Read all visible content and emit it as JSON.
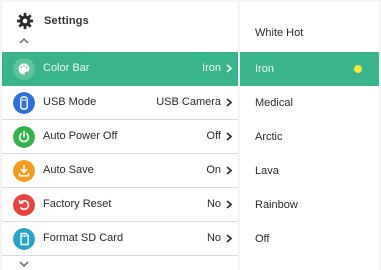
{
  "header": {
    "title": "Settings",
    "icon": "gear-icon"
  },
  "colors": {
    "accent": "#3ab58b",
    "selected_dot": "#f3e73a"
  },
  "settings": [
    {
      "label": "Color Bar",
      "value": "Iron",
      "icon": "palette-icon",
      "icon_color": "#5cc39a",
      "active": true
    },
    {
      "label": "USB Mode",
      "value": "USB Camera",
      "icon": "usb-icon",
      "icon_color": "#2f6fd6",
      "active": false
    },
    {
      "label": "Auto Power Off",
      "value": "Off",
      "icon": "power-icon",
      "icon_color": "#35b34a",
      "active": false
    },
    {
      "label": "Auto Save",
      "value": "On",
      "icon": "save-download-icon",
      "icon_color": "#f29b1d",
      "active": false
    },
    {
      "label": "Factory Reset",
      "value": "No",
      "icon": "reset-icon",
      "icon_color": "#e8433e",
      "active": false
    },
    {
      "label": "Format SD Card",
      "value": "No",
      "icon": "sd-card-icon",
      "icon_color": "#27a3c9",
      "active": false
    }
  ],
  "color_bar_options": [
    {
      "label": "White Hot",
      "selected": false
    },
    {
      "label": "Iron",
      "selected": true
    },
    {
      "label": "Medical",
      "selected": false
    },
    {
      "label": "Arctic",
      "selected": false
    },
    {
      "label": "Lava",
      "selected": false
    },
    {
      "label": "Rainbow",
      "selected": false
    },
    {
      "label": "Off",
      "selected": false
    }
  ]
}
